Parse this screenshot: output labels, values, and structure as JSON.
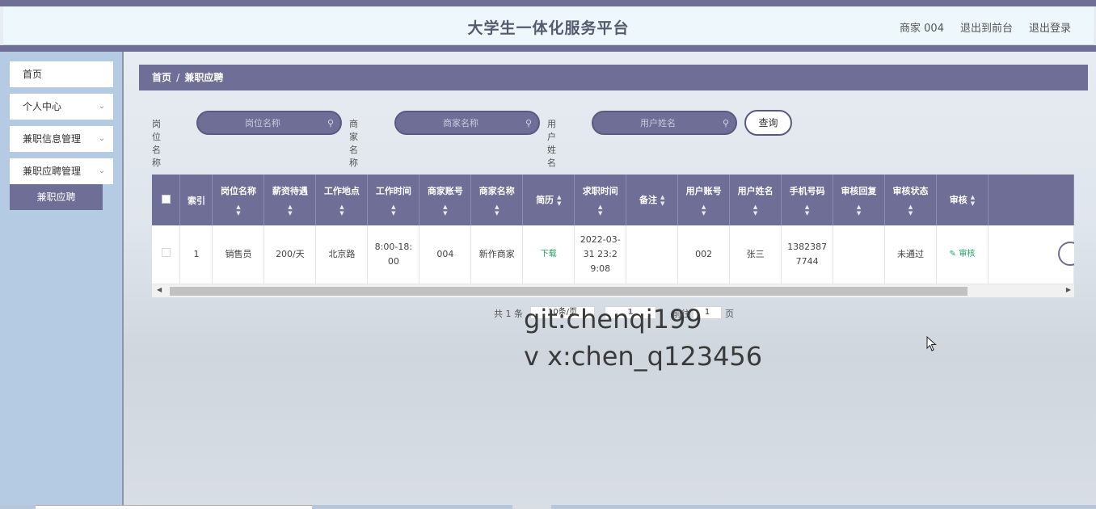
{
  "header": {
    "title": "大学生一体化服务平台",
    "user": "商家 004",
    "back_to_front": "退出到前台",
    "logout": "退出登录"
  },
  "sidebar": {
    "items": [
      {
        "label": "首页"
      },
      {
        "label": "个人中心"
      },
      {
        "label": "兼职信息管理"
      },
      {
        "label": "兼职应聘管理"
      }
    ],
    "active_sub": "兼职应聘"
  },
  "breadcrumb": {
    "home": "首页",
    "sep": "/",
    "current": "兼职应聘"
  },
  "search": {
    "job_label": "岗位名称",
    "job_placeholder": "岗位名称",
    "merchant_label": "商家名称",
    "merchant_placeholder": "商家名称",
    "user_label": "用户姓名",
    "user_placeholder": "用户姓名",
    "query_button": "查询"
  },
  "table": {
    "columns": [
      "索引",
      "岗位名称",
      "薪资待遇",
      "工作地点",
      "工作时间",
      "商家账号",
      "商家名称",
      "简历",
      "求职时间",
      "备注",
      "用户账号",
      "用户姓名",
      "手机号码",
      "审核回复",
      "审核状态",
      "审核"
    ],
    "rows": [
      {
        "index": "1",
        "job": "销售员",
        "salary": "200/天",
        "location": "北京路",
        "work_time": "8:00-18:00",
        "merchant_account": "004",
        "merchant_name": "新作商家",
        "resume": "下载",
        "apply_time": "2022-03-31 23:29:08",
        "remark": "",
        "user_account": "002",
        "user_name": "张三",
        "phone": "13823877744",
        "reply": "",
        "status": "未通过",
        "audit": "审核"
      }
    ]
  },
  "pagination": {
    "total": "共 1 条",
    "page_size": "10条/页",
    "page": "1",
    "goto": "前往",
    "goto_value": "1",
    "unit": "页"
  },
  "watermark": {
    "line1": "git:chenqi199",
    "line2": "v x:chen_q123456"
  },
  "colors": {
    "primary": "#6e6e96",
    "sidebar": "#b4cbe3",
    "header_bg": "#eef7fc",
    "link_green": "#1fa464"
  }
}
